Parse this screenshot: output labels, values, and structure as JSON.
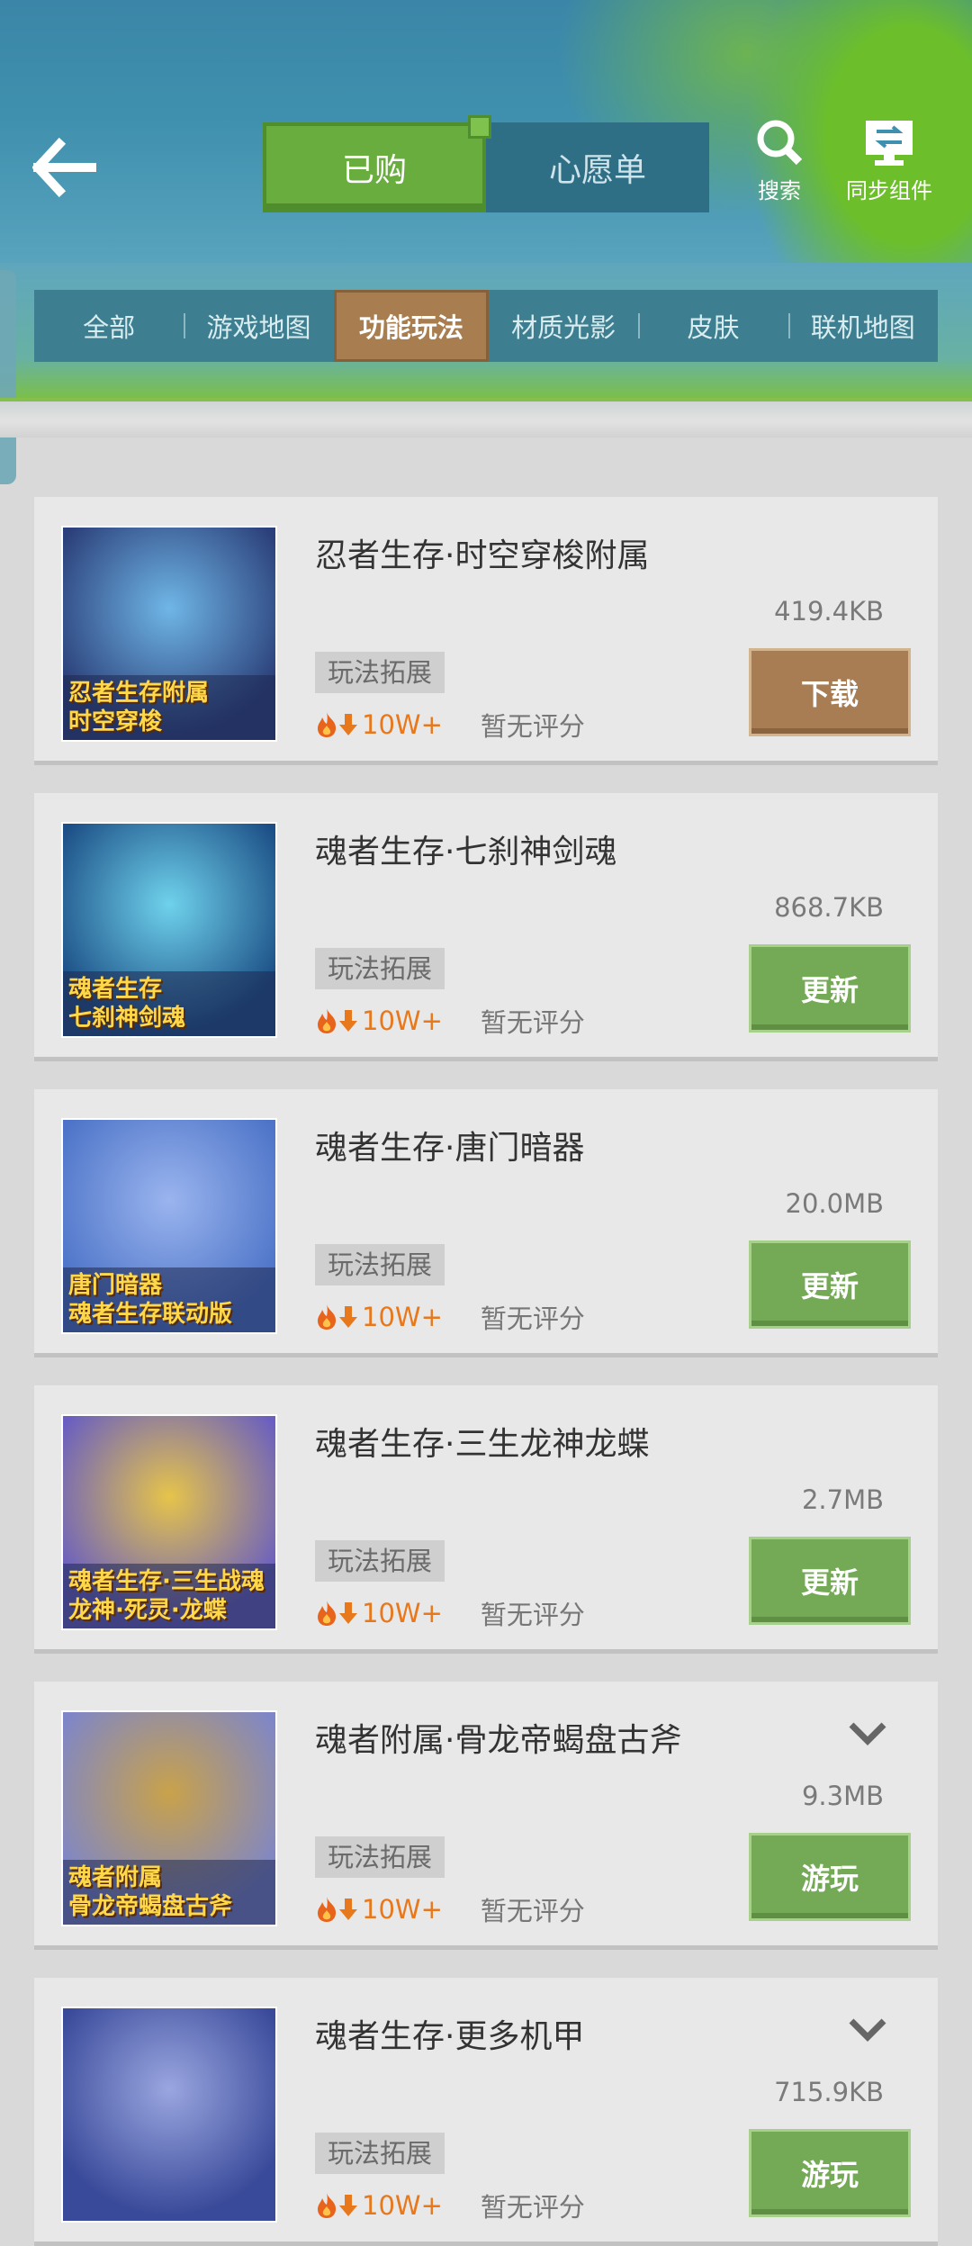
{
  "header": {
    "tabs": [
      {
        "label": "已购",
        "active": true
      },
      {
        "label": "心愿单",
        "active": false
      }
    ],
    "search_label": "搜索",
    "sync_label": "同步组件"
  },
  "categories": [
    {
      "label": "全部",
      "active": false
    },
    {
      "label": "游戏地图",
      "active": false
    },
    {
      "label": "功能玩法",
      "active": true
    },
    {
      "label": "材质光影",
      "active": false
    },
    {
      "label": "皮肤",
      "active": false
    },
    {
      "label": "联机地图",
      "active": false
    }
  ],
  "items": [
    {
      "title": "忍者生存·时空穿梭附属",
      "size": "419.4KB",
      "tag": "玩法拓展",
      "heat": "10W+",
      "rating": "暂无评分",
      "action": "下载",
      "action_style": "brown",
      "thumb_caption": [
        "忍者生存附属",
        "时空穿梭"
      ],
      "thumb_colors": [
        "#2b3f7a",
        "#6fb6e6"
      ],
      "has_chevron": false
    },
    {
      "title": "魂者生存·七刹神剑魂",
      "size": "868.7KB",
      "tag": "玩法拓展",
      "heat": "10W+",
      "rating": "暂无评分",
      "action": "更新",
      "action_style": "green",
      "thumb_caption": [
        "魂者生存",
        "七刹神剑魂"
      ],
      "thumb_colors": [
        "#1c4f86",
        "#6fd2ec"
      ],
      "has_chevron": false
    },
    {
      "title": "魂者生存·唐门暗器",
      "size": "20.0MB",
      "tag": "玩法拓展",
      "heat": "10W+",
      "rating": "暂无评分",
      "action": "更新",
      "action_style": "green",
      "thumb_caption": [
        "唐门暗器",
        "魂者生存联动版"
      ],
      "thumb_colors": [
        "#4d74c8",
        "#9ab4ee"
      ],
      "has_chevron": false
    },
    {
      "title": "魂者生存·三生龙神龙蝶",
      "size": "2.7MB",
      "tag": "玩法拓展",
      "heat": "10W+",
      "rating": "暂无评分",
      "action": "更新",
      "action_style": "green",
      "thumb_caption": [
        "魂者生存·三生战魂",
        "龙神·死灵·龙蝶"
      ],
      "thumb_colors": [
        "#6a5fc0",
        "#e6c44a"
      ],
      "has_chevron": false
    },
    {
      "title": "魂者附属·骨龙帝蝎盘古斧",
      "size": "9.3MB",
      "tag": "玩法拓展",
      "heat": "10W+",
      "rating": "暂无评分",
      "action": "游玩",
      "action_style": "green",
      "thumb_caption": [
        "魂者附属",
        "骨龙帝蝎盘古斧"
      ],
      "thumb_colors": [
        "#7e86c8",
        "#c9a24a"
      ],
      "has_chevron": true
    },
    {
      "title": "魂者生存·更多机甲",
      "size": "715.9KB",
      "tag": "玩法拓展",
      "heat": "10W+",
      "rating": "暂无评分",
      "action": "游玩",
      "action_style": "green",
      "thumb_caption": [],
      "thumb_colors": [
        "#3a4a9a",
        "#9aa6e0"
      ],
      "has_chevron": true
    }
  ]
}
